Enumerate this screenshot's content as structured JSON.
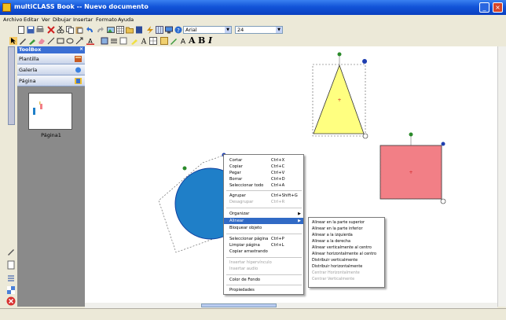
{
  "window": {
    "title": "multiCLASS Book -- Nuevo documento"
  },
  "menubar": {
    "items": [
      "Archivo",
      "Editar",
      "Ver",
      "Dibujar",
      "Insertar",
      "Formato",
      "Ayuda"
    ]
  },
  "format_toolbar": {
    "font_name": "Arial",
    "font_size": "24",
    "bold_label": "A",
    "bold_label2": "B",
    "italic_label": "I"
  },
  "toolbox": {
    "title": "ToolBox",
    "sections": [
      "Plantilla",
      "Galería",
      "Página"
    ],
    "page_thumb_label": "Página1"
  },
  "context_menu": {
    "items": [
      {
        "label": "Cortar",
        "shortcut": "Ctrl+X"
      },
      {
        "label": "Copiar",
        "shortcut": "Ctrl+C"
      },
      {
        "label": "Pegar",
        "shortcut": "Ctrl+V"
      },
      {
        "label": "Borrar",
        "shortcut": "Ctrl+D"
      },
      {
        "label": "Seleccionar todo",
        "shortcut": "Ctrl+A"
      },
      {
        "label": "Agrupar",
        "shortcut": "Ctrl+Shift+G"
      },
      {
        "label": "Desagrupar",
        "shortcut": "Ctrl+R"
      },
      {
        "label": "Organizar"
      },
      {
        "label": "Alinear"
      },
      {
        "label": "Bloquear objeto"
      },
      {
        "label": "Seleccionar página",
        "shortcut": "Ctrl+P"
      },
      {
        "label": "Limpiar página",
        "shortcut": "Ctrl+L"
      },
      {
        "label": "Copiar arrastrando"
      },
      {
        "label": "Insertar hipervínculo"
      },
      {
        "label": "Insertar audio"
      },
      {
        "label": "Color de Fondo"
      },
      {
        "label": "Propiedades"
      }
    ]
  },
  "submenu_alinear": {
    "items": [
      "Alinear en la parte superior",
      "Alinear en la parte inferior",
      "Alinear a la izquierda",
      "Alinear a la derecha",
      "Alinear verticalmente al centro",
      "Alinear horizontalmente al centro",
      "Distribuir verticalmente",
      "Distribuir horizontalmente",
      "Centrar Horizontalmente",
      "Centrar Verticalmente"
    ]
  },
  "colors": {
    "title_bar": "#1254d8",
    "triangle_fill": "#ffff80",
    "square_fill": "#f27f86",
    "circle_fill": "#1f7fc8",
    "menu_highlight": "#316ac5"
  }
}
